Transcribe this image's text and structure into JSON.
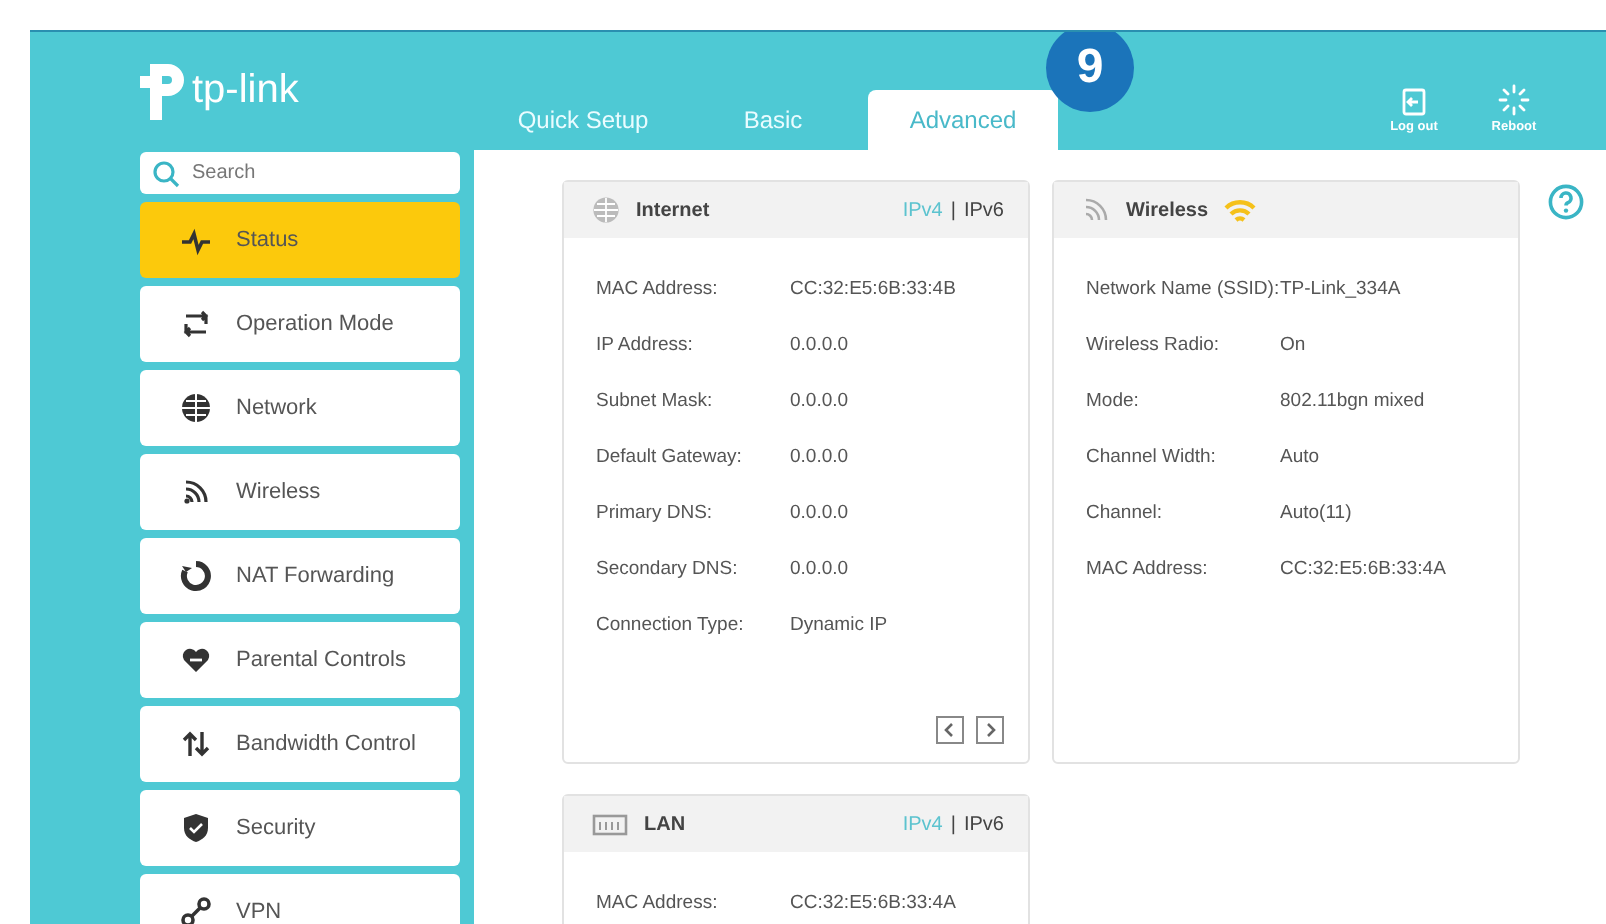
{
  "brand": {
    "name": "tp-link"
  },
  "tabs": [
    {
      "label": "Quick Setup",
      "selected": false
    },
    {
      "label": "Basic",
      "selected": false
    },
    {
      "label": "Advanced",
      "selected": true
    }
  ],
  "step_badge": "9",
  "header_actions": [
    {
      "label": "Log out"
    },
    {
      "label": "Reboot"
    }
  ],
  "search": {
    "placeholder": "Search"
  },
  "sidebar": {
    "items": [
      {
        "label": "Status",
        "selected": true
      },
      {
        "label": "Operation Mode",
        "selected": false
      },
      {
        "label": "Network",
        "selected": false
      },
      {
        "label": "Wireless",
        "selected": false
      },
      {
        "label": "NAT Forwarding",
        "selected": false
      },
      {
        "label": "Parental Controls",
        "selected": false
      },
      {
        "label": "Bandwidth Control",
        "selected": false
      },
      {
        "label": "Security",
        "selected": false
      },
      {
        "label": "VPN",
        "selected": false
      }
    ]
  },
  "panels": [
    {
      "title": "Internet",
      "protocols": [
        {
          "label": "IPv4",
          "selected": true
        },
        {
          "label": "IPv6",
          "selected": false
        }
      ],
      "separator": "|",
      "pager": true,
      "rows": [
        {
          "label": "MAC Address:",
          "value": "CC:32:E5:6B:33:4B"
        },
        {
          "label": "IP Address:",
          "value": "0.0.0.0"
        },
        {
          "label": "Subnet Mask:",
          "value": "0.0.0.0"
        },
        {
          "label": "Default Gateway:",
          "value": "0.0.0.0"
        },
        {
          "label": "Primary DNS:",
          "value": "0.0.0.0"
        },
        {
          "label": "Secondary DNS:",
          "value": "0.0.0.0"
        },
        {
          "label": "Connection Type:",
          "value": "Dynamic IP"
        }
      ]
    },
    {
      "title": "Wireless",
      "signal": true,
      "rows": [
        {
          "label": "Network Name (SSID):",
          "value": "TP-Link_334A"
        },
        {
          "label": "Wireless Radio:",
          "value": "On"
        },
        {
          "label": "Mode:",
          "value": "802.11bgn mixed"
        },
        {
          "label": "Channel Width:",
          "value": "Auto"
        },
        {
          "label": "Channel:",
          "value": "Auto(11)"
        },
        {
          "label": "MAC Address:",
          "value": "CC:32:E5:6B:33:4A"
        }
      ]
    },
    {
      "title": "LAN",
      "protocols": [
        {
          "label": "IPv4",
          "selected": true
        },
        {
          "label": "IPv6",
          "selected": false
        }
      ],
      "separator": "|",
      "rows": [
        {
          "label": "MAC Address:",
          "value": "CC:32:E5:6B:33:4A"
        }
      ]
    }
  ]
}
